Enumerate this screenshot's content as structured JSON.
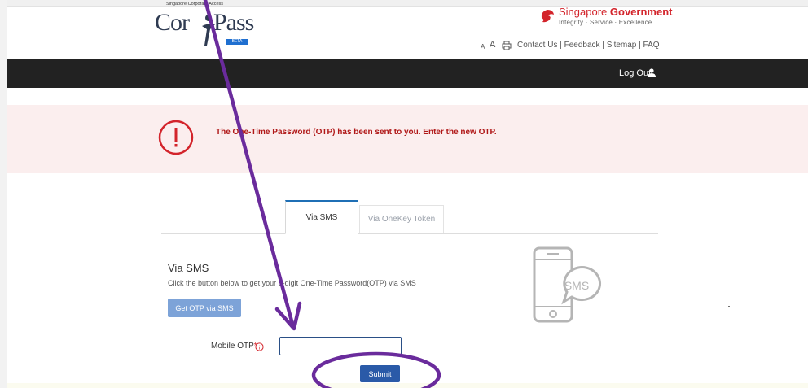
{
  "header": {
    "logo_small_text": "Singapore Corporate Access",
    "logo_cor": "Cor",
    "logo_pass": "Pass",
    "logo_beta": "BETA",
    "gov_title_prefix": "Singapore ",
    "gov_title_bold": "Government",
    "gov_subtitle": "Integrity · Service · Excellence",
    "font_small": "A",
    "font_large": "A",
    "links": "Contact Us | Feedback | Sitemap | FAQ"
  },
  "nav": {
    "logout_label": "Log Out"
  },
  "alert": {
    "message": "The One-Time Password (OTP) has been sent to you. Enter the new OTP."
  },
  "tabs": [
    {
      "label": "Via SMS",
      "active": true
    },
    {
      "label": "Via OneKey Token",
      "active": false
    }
  ],
  "content": {
    "heading": "Via SMS",
    "description": "Click the button below to get your 6-digit One-Time Password(OTP) via SMS",
    "get_otp_button": "Get OTP via SMS",
    "otp_label": "Mobile OTP",
    "otp_required_mark": "*",
    "otp_value": "",
    "submit_button": "Submit",
    "illustration_text": "SMS"
  },
  "colors": {
    "navbar": "#222222",
    "alert_bg": "#fbeeee",
    "alert_text": "#b01818",
    "primary_button": "#2a5aa8",
    "secondary_button": "#7da3d8",
    "annotation": "#6a2b9c"
  },
  "icons": [
    "lion-head-icon",
    "print-icon",
    "user-icon",
    "exclamation-circle-icon",
    "info-icon",
    "phone-sms-icon"
  ]
}
